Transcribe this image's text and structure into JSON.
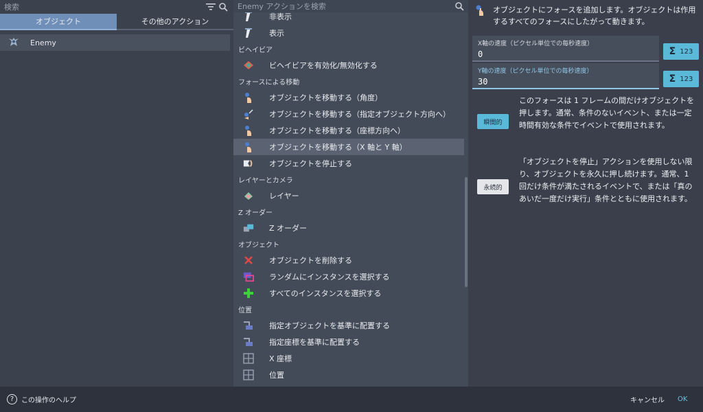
{
  "left": {
    "search_placeholder": "検索",
    "tabs": [
      "オブジェクト",
      "その他のアクション"
    ],
    "objects": [
      {
        "name": "Enemy"
      }
    ]
  },
  "middle": {
    "search_placeholder": "Enemy アクションを検索",
    "items": [
      {
        "kind": "item",
        "label": "非表示",
        "icon": "visibility-icon"
      },
      {
        "kind": "item",
        "label": "表示",
        "icon": "visibility-icon"
      },
      {
        "kind": "cat",
        "label": "ビヘイビア"
      },
      {
        "kind": "item",
        "label": "ビヘイビアを有効化/無効化する",
        "icon": "behavior-icon"
      },
      {
        "kind": "cat",
        "label": "フォースによる移動"
      },
      {
        "kind": "item",
        "label": "オブジェクトを移動する（角度）",
        "icon": "force-icon"
      },
      {
        "kind": "item",
        "label": "オブジェクトを移動する（指定オブジェクト方向へ）",
        "icon": "force-toward-icon"
      },
      {
        "kind": "item",
        "label": "オブジェクトを移動する（座標方向へ）",
        "icon": "force-icon"
      },
      {
        "kind": "item",
        "label": "オブジェクトを移動する（X 軸と Y 軸）",
        "icon": "force-icon",
        "selected": true
      },
      {
        "kind": "item",
        "label": "オブジェクトを停止する",
        "icon": "stop-icon"
      },
      {
        "kind": "cat",
        "label": "レイヤーとカメラ"
      },
      {
        "kind": "item",
        "label": "レイヤー",
        "icon": "layer-icon"
      },
      {
        "kind": "cat",
        "label": "Z オーダー"
      },
      {
        "kind": "item",
        "label": "Z オーダー",
        "icon": "zorder-icon"
      },
      {
        "kind": "cat",
        "label": "オブジェクト"
      },
      {
        "kind": "item",
        "label": "オブジェクトを削除する",
        "icon": "delete-icon"
      },
      {
        "kind": "item",
        "label": "ランダムにインスタンスを選択する",
        "icon": "random-pick-icon"
      },
      {
        "kind": "item",
        "label": "すべてのインスタンスを選択する",
        "icon": "add-icon"
      },
      {
        "kind": "cat",
        "label": "位置"
      },
      {
        "kind": "item",
        "label": "指定オブジェクトを基準に配置する",
        "icon": "position-icon"
      },
      {
        "kind": "item",
        "label": "指定座標を基準に配置する",
        "icon": "position-icon"
      },
      {
        "kind": "item",
        "label": "X 座標",
        "icon": "grid-icon"
      },
      {
        "kind": "item",
        "label": "位置",
        "icon": "grid-icon"
      }
    ]
  },
  "right": {
    "description": "オブジェクトにフォースを追加します。オブジェクトは作用するすべてのフォースにしたがって動きます。",
    "fields": [
      {
        "label": "X軸の速度（ピクセル単位での毎秒速度）",
        "value": "0"
      },
      {
        "label": "Y軸の速度（ピクセル単位での毎秒速度）",
        "value": "30"
      }
    ],
    "expr_button_label": "123",
    "modes": [
      {
        "label": "瞬間的",
        "text": "このフォースは 1 フレームの間だけオブジェクトを押します。通常、条件のないイベント、または一定時間有効な条件でイベントで使用されます。",
        "active": true
      },
      {
        "label": "永続的",
        "text": "「オブジェクトを停止」アクションを使用しない限り、オブジェクトを永久に押し続けます。通常、1回だけ条件が満たされるイベントで、または「真のあいだ一度だけ実行」条件とともに使用されます。",
        "active": false
      }
    ]
  },
  "footer": {
    "help": "この操作のヘルプ",
    "cancel": "キャンセル",
    "ok": "OK"
  },
  "colors": {
    "accent": "#5ab9d8",
    "tab_active": "#6f8fb8",
    "ok_text": "#6fc1e0"
  }
}
